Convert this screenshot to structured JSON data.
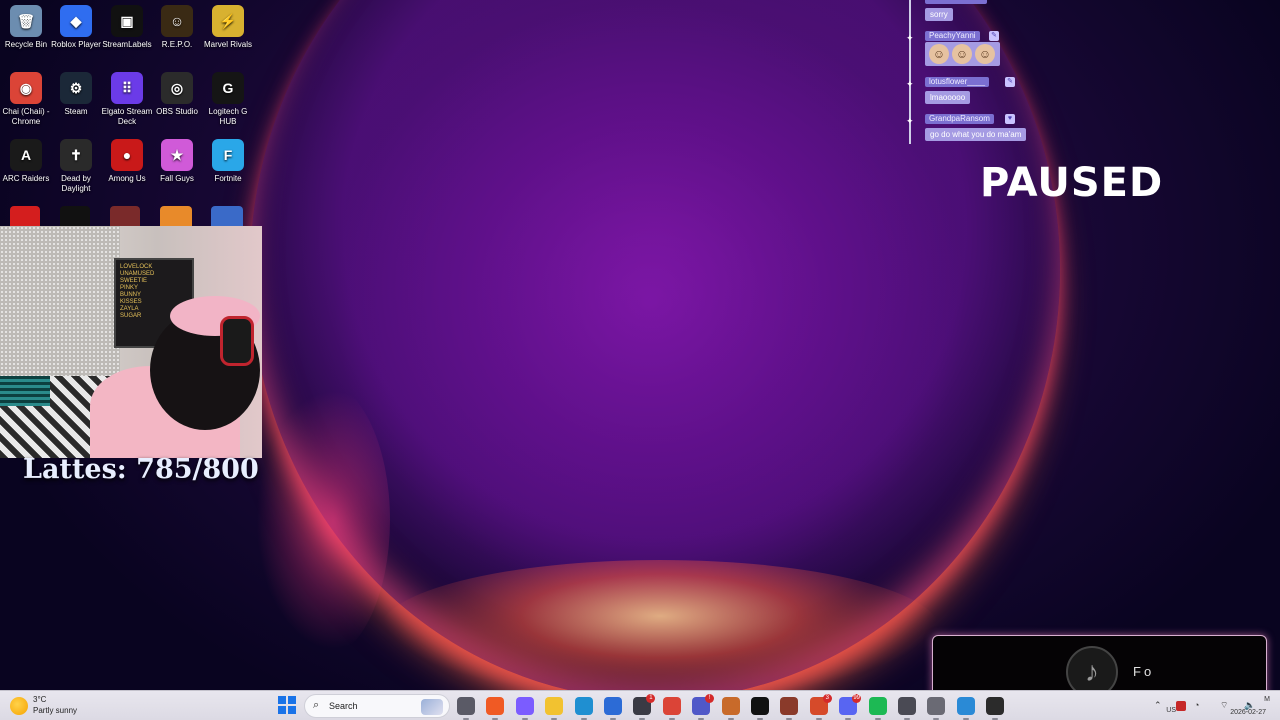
{
  "desktop_icons": [
    {
      "label": "Recycle Bin",
      "icon": "recycle-bin-icon",
      "color": "#6c8db0",
      "glyph": "🗑"
    },
    {
      "label": "Roblox Player",
      "icon": "roblox-icon",
      "color": "#2f6df0",
      "glyph": "◆"
    },
    {
      "label": "StreamLabels",
      "icon": "streamlabels-icon",
      "color": "#111111",
      "glyph": "▣"
    },
    {
      "label": "R.E.P.O.",
      "icon": "repo-icon",
      "color": "#3a2a14",
      "glyph": "☺"
    },
    {
      "label": "Marvel Rivals",
      "icon": "marvel-rivals-icon",
      "color": "#d8b130",
      "glyph": "⚡"
    },
    {
      "label": "Chai (Chaii) - Chrome",
      "icon": "chrome-icon",
      "color": "#db4437",
      "glyph": "◉"
    },
    {
      "label": "Steam",
      "icon": "steam-icon",
      "color": "#1b2838",
      "glyph": "⚙"
    },
    {
      "label": "Elgato Stream Deck",
      "icon": "stream-deck-icon",
      "color": "#6b3be8",
      "glyph": "⠿"
    },
    {
      "label": "OBS Studio",
      "icon": "obs-icon",
      "color": "#2b2b2b",
      "glyph": "◎"
    },
    {
      "label": "Logitech G HUB",
      "icon": "logitech-icon",
      "color": "#151515",
      "glyph": "G"
    },
    {
      "label": "ARC Raiders",
      "icon": "arc-raiders-icon",
      "color": "#1a1a1a",
      "glyph": "A"
    },
    {
      "label": "Dead by Daylight",
      "icon": "dead-by-daylight-icon",
      "color": "#2a2a2a",
      "glyph": "✝"
    },
    {
      "label": "Among Us",
      "icon": "among-us-icon",
      "color": "#c91919",
      "glyph": "●"
    },
    {
      "label": "Fall Guys",
      "icon": "fall-guys-icon",
      "color": "#d05ad8",
      "glyph": "★"
    },
    {
      "label": "Fortnite",
      "icon": "fortnite-icon",
      "color": "#2aa7e8",
      "glyph": "F"
    }
  ],
  "webcam": {
    "board_lines": [
      "LOVELOCK",
      "UNAMUSED",
      "SWEETIE",
      "PINKY",
      "BUNNY",
      "KISSES",
      "ZAYLA",
      "SUGAR"
    ]
  },
  "counter": {
    "text": "Lattes: 785/800"
  },
  "chat": {
    "messages": [
      {
        "user": "",
        "text": "sorry",
        "type": "text"
      },
      {
        "user": "PeachyYanni",
        "text": "",
        "type": "emotes",
        "emotes": [
          "☺",
          "☺",
          "☺"
        ]
      },
      {
        "user": "lotusflower____",
        "text": "lmaooooo",
        "type": "text"
      },
      {
        "user": "GrandpaRansom",
        "text": "go do what you do ma'am",
        "type": "text"
      }
    ]
  },
  "overlay": {
    "paused": "PAUSED"
  },
  "tiktok_widget": {
    "text": "Fo",
    "icon": "tiktok-icon"
  },
  "taskbar": {
    "weather_temp": "3°C",
    "weather_desc": "Partly sunny",
    "search_label": "Search",
    "apps": [
      {
        "icon": "task-view-icon",
        "color": "#5a5a66",
        "badge": ""
      },
      {
        "icon": "brave-icon",
        "color": "#f05a24",
        "badge": ""
      },
      {
        "icon": "copilot-icon",
        "color": "#7b5cff",
        "badge": ""
      },
      {
        "icon": "file-explorer-icon",
        "color": "#f2c230",
        "badge": ""
      },
      {
        "icon": "edge-icon",
        "color": "#1f8fd1",
        "badge": ""
      },
      {
        "icon": "photo-app-icon",
        "color": "#2c6bd6",
        "badge": ""
      },
      {
        "icon": "store-icon",
        "color": "#3a3a44",
        "badge": "1"
      },
      {
        "icon": "chrome-icon",
        "color": "#db4437",
        "badge": ""
      },
      {
        "icon": "teams-icon",
        "color": "#5058c8",
        "badge": "!"
      },
      {
        "icon": "creature-icon",
        "color": "#c86a2a",
        "badge": ""
      },
      {
        "icon": "tiktok-icon",
        "color": "#111111",
        "badge": ""
      },
      {
        "icon": "app-icon",
        "color": "#8a3a2a",
        "badge": ""
      },
      {
        "icon": "game-icon",
        "color": "#d64a2a",
        "badge": "3"
      },
      {
        "icon": "discord-icon",
        "color": "#5865f2",
        "badge": "99"
      },
      {
        "icon": "spotify-icon",
        "color": "#1db954",
        "badge": ""
      },
      {
        "icon": "calculator-icon",
        "color": "#4a4a54",
        "badge": ""
      },
      {
        "icon": "tray-app-icon",
        "color": "#6a6a74",
        "badge": ""
      },
      {
        "icon": "window-icon",
        "color": "#2a8ad6",
        "badge": ""
      },
      {
        "icon": "obs-icon",
        "color": "#2b2b2b",
        "badge": ""
      }
    ],
    "lang": "US",
    "time": "M",
    "date": "2026-02-27"
  }
}
